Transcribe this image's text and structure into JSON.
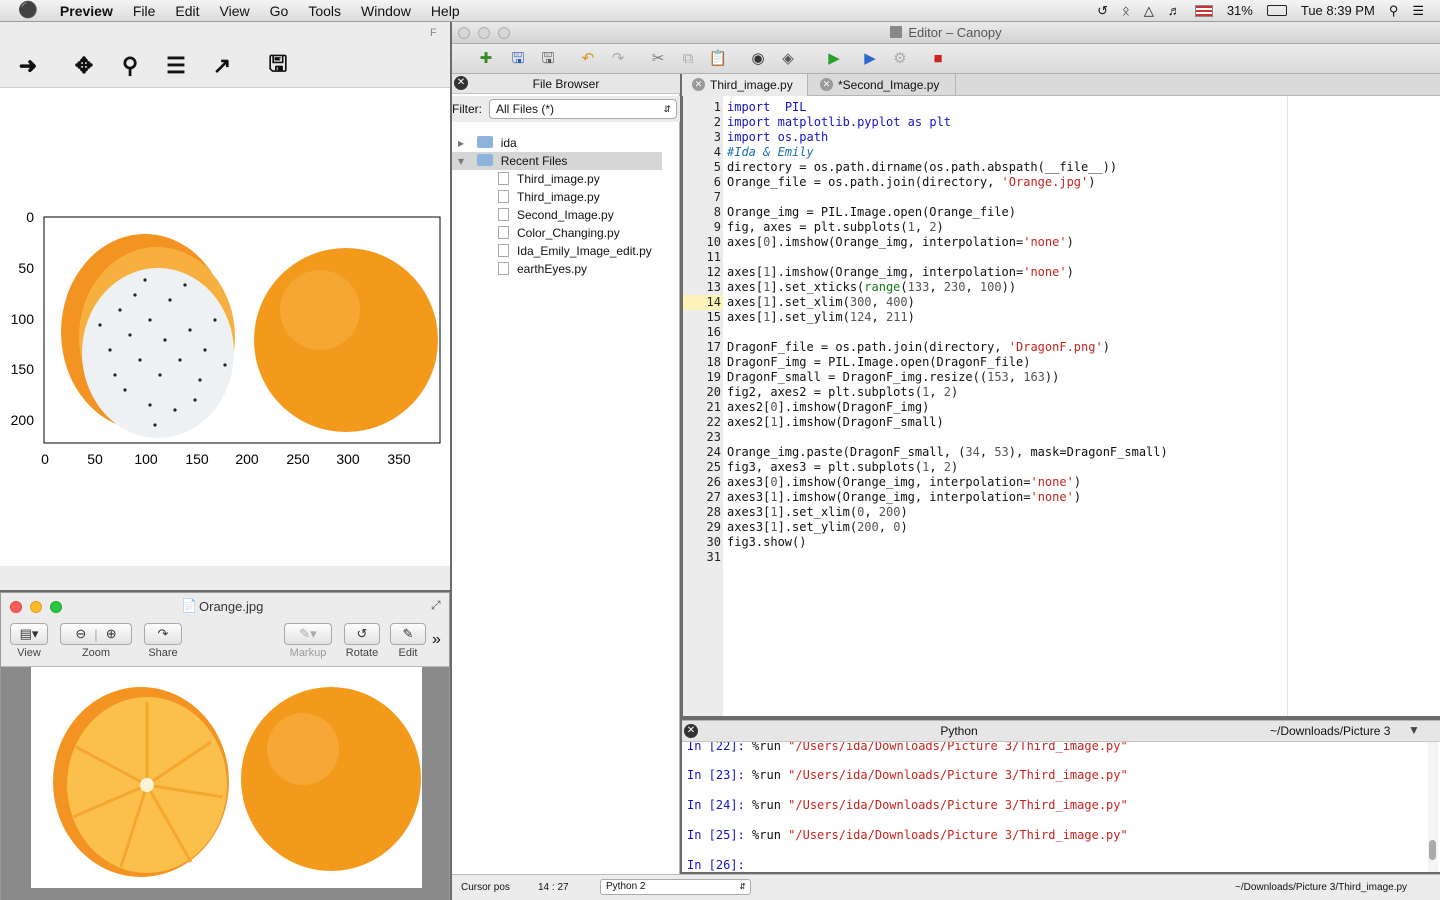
{
  "menubar": {
    "apple": "",
    "app": "Preview",
    "items": [
      "File",
      "Edit",
      "View",
      "Go",
      "Tools",
      "Window",
      "Help"
    ],
    "battery": "31%",
    "clock": "Tue 8:39 PM"
  },
  "mpl": {
    "window_title_fragment": "F",
    "tools": [
      "forward-arrow",
      "move",
      "zoom",
      "configure",
      "edit-curves",
      "save"
    ],
    "plot": {
      "yticks": [
        "0",
        "50",
        "100",
        "150",
        "200"
      ],
      "xticks": [
        "0",
        "50",
        "100",
        "150",
        "200",
        "250",
        "300",
        "350"
      ]
    }
  },
  "preview": {
    "title": "Orange.jpg",
    "buttons": [
      "View",
      "Zoom",
      "Share",
      "Markup",
      "Rotate",
      "Edit"
    ],
    "more": "»"
  },
  "canopy": {
    "title": "Editor – Canopy",
    "file_browser": {
      "header": "File Browser",
      "filter_label": "Filter:",
      "filter_value": "All Files (*)",
      "folders": [
        "ida",
        "Recent Files"
      ],
      "files": [
        "Third_image.py",
        "Third_image.py",
        "Second_Image.py",
        "Color_Changing.py",
        "Ida_Emily_Image_edit.py",
        "earthEyes.py"
      ]
    },
    "tabs": [
      "Third_image.py",
      "*Second_Image.py"
    ],
    "code": [
      [
        [
          "kw",
          "import"
        ],
        [
          "",
          "  "
        ],
        [
          "kw",
          "PIL"
        ]
      ],
      [
        [
          "kw",
          "import"
        ],
        [
          "",
          " "
        ],
        [
          "kw",
          "matplotlib.pyplot"
        ],
        [
          "",
          " "
        ],
        [
          "kw",
          "as"
        ],
        [
          "",
          " "
        ],
        [
          "kw",
          "plt"
        ]
      ],
      [
        [
          "kw",
          "import"
        ],
        [
          "",
          " "
        ],
        [
          "kw",
          "os.path"
        ]
      ],
      [
        [
          "cm",
          "#Ida & Emily"
        ]
      ],
      [
        [
          "",
          "directory = os.path.dirname(os.path.abspath(__file__))"
        ]
      ],
      [
        [
          "",
          "Orange_file = os.path.join(directory, "
        ],
        [
          "st",
          "'Orange.jpg'"
        ],
        [
          "",
          ")"
        ]
      ],
      [],
      [
        [
          "",
          "Orange_img = PIL.Image.open(Orange_file)"
        ]
      ],
      [
        [
          "",
          "fig, axes = plt.subplots("
        ],
        [
          "nm",
          "1"
        ],
        [
          "",
          ", "
        ],
        [
          "nm",
          "2"
        ],
        [
          "",
          ")"
        ]
      ],
      [
        [
          "",
          "axes["
        ],
        [
          "nm",
          "0"
        ],
        [
          "",
          "].imshow(Orange_img, interpolation="
        ],
        [
          "st",
          "'none'"
        ],
        [
          "",
          ")"
        ]
      ],
      [],
      [
        [
          "",
          "axes["
        ],
        [
          "nm",
          "1"
        ],
        [
          "",
          "].imshow(Orange_img, interpolation="
        ],
        [
          "st",
          "'none'"
        ],
        [
          "",
          ")"
        ]
      ],
      [
        [
          "",
          "axes["
        ],
        [
          "nm",
          "1"
        ],
        [
          "",
          "].set_xticks("
        ],
        [
          "nb",
          "range"
        ],
        [
          "",
          "("
        ],
        [
          "nm",
          "133"
        ],
        [
          "",
          ", "
        ],
        [
          "nm",
          "230"
        ],
        [
          "",
          ", "
        ],
        [
          "nm",
          "100"
        ],
        [
          "",
          "))"
        ]
      ],
      [
        [
          "",
          "axes["
        ],
        [
          "nm",
          "1"
        ],
        [
          "",
          "].set_xlim("
        ],
        [
          "nm",
          "300"
        ],
        [
          "",
          ", "
        ],
        [
          "nm",
          "400"
        ],
        [
          "",
          ")"
        ]
      ],
      [
        [
          "",
          "axes["
        ],
        [
          "nm",
          "1"
        ],
        [
          "",
          "].set_ylim("
        ],
        [
          "nm",
          "124"
        ],
        [
          "",
          ", "
        ],
        [
          "nm",
          "211"
        ],
        [
          "",
          ")"
        ]
      ],
      [],
      [
        [
          "",
          "DragonF_file = os.path.join(directory, "
        ],
        [
          "st",
          "'DragonF.png'"
        ],
        [
          "",
          ")"
        ]
      ],
      [
        [
          "",
          "DragonF_img = PIL.Image.open(DragonF_file)"
        ]
      ],
      [
        [
          "",
          "DragonF_small = DragonF_img.resize(("
        ],
        [
          "nm",
          "153"
        ],
        [
          "",
          ", "
        ],
        [
          "nm",
          "163"
        ],
        [
          "",
          "))"
        ]
      ],
      [
        [
          "",
          "fig2, axes2 = plt.subplots("
        ],
        [
          "nm",
          "1"
        ],
        [
          "",
          ", "
        ],
        [
          "nm",
          "2"
        ],
        [
          "",
          ")"
        ]
      ],
      [
        [
          "",
          "axes2["
        ],
        [
          "nm",
          "0"
        ],
        [
          "",
          "].imshow(DragonF_img)"
        ]
      ],
      [
        [
          "",
          "axes2["
        ],
        [
          "nm",
          "1"
        ],
        [
          "",
          "].imshow(DragonF_small)"
        ]
      ],
      [],
      [
        [
          "",
          "Orange_img.paste(DragonF_small, ("
        ],
        [
          "nm",
          "34"
        ],
        [
          "",
          ", "
        ],
        [
          "nm",
          "53"
        ],
        [
          "",
          "), mask=DragonF_small)"
        ]
      ],
      [
        [
          "",
          "fig3, axes3 = plt.subplots("
        ],
        [
          "nm",
          "1"
        ],
        [
          "",
          ", "
        ],
        [
          "nm",
          "2"
        ],
        [
          "",
          ")"
        ]
      ],
      [
        [
          "",
          "axes3["
        ],
        [
          "nm",
          "0"
        ],
        [
          "",
          "].imshow(Orange_img, interpolation="
        ],
        [
          "st",
          "'none'"
        ],
        [
          "",
          ")"
        ]
      ],
      [
        [
          "",
          "axes3["
        ],
        [
          "nm",
          "1"
        ],
        [
          "",
          "].imshow(Orange_img, interpolation="
        ],
        [
          "st",
          "'none'"
        ],
        [
          "",
          ")"
        ]
      ],
      [
        [
          "",
          "axes3["
        ],
        [
          "nm",
          "1"
        ],
        [
          "",
          "].set_xlim("
        ],
        [
          "nm",
          "0"
        ],
        [
          "",
          ", "
        ],
        [
          "nm",
          "200"
        ],
        [
          "",
          ")"
        ]
      ],
      [
        [
          "",
          "axes3["
        ],
        [
          "nm",
          "1"
        ],
        [
          "",
          "].set_ylim("
        ],
        [
          "nm",
          "200"
        ],
        [
          "",
          ", "
        ],
        [
          "nm",
          "0"
        ],
        [
          "",
          ")"
        ]
      ],
      [
        [
          "",
          "fig3.show()"
        ]
      ],
      []
    ],
    "current_line": 14,
    "python": {
      "header": "Python",
      "path": "~/Downloads/Picture 3",
      "lines": [
        {
          "prompt": "In [22]:",
          "cmd": "%run ",
          "arg": "\"/Users/ida/Downloads/Picture 3/Third_image.py\""
        },
        {
          "prompt": "In [23]:",
          "cmd": "%run ",
          "arg": "\"/Users/ida/Downloads/Picture 3/Third_image.py\""
        },
        {
          "prompt": "In [24]:",
          "cmd": "%run ",
          "arg": "\"/Users/ida/Downloads/Picture 3/Third_image.py\""
        },
        {
          "prompt": "In [25]:",
          "cmd": "%run ",
          "arg": "\"/Users/ida/Downloads/Picture 3/Third_image.py\""
        },
        {
          "prompt": "In [26]:",
          "cmd": "",
          "arg": ""
        }
      ]
    },
    "status": {
      "cursor_label": "Cursor pos",
      "cursor_value": "14 : 27",
      "kernel": "Python 2",
      "file_path": "~/Downloads/Picture 3/Third_image.py"
    }
  }
}
